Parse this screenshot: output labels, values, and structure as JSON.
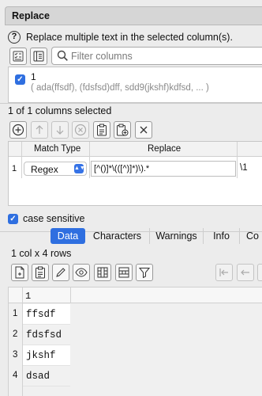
{
  "window": {
    "title": "Replace"
  },
  "help": {
    "text": "Replace multiple text in the selected column(s)."
  },
  "search": {
    "placeholder": "Filter columns",
    "value": ""
  },
  "columns": [
    {
      "name": "1",
      "values": "( ada(ffsdf), (fdsfsd)dff, sdd9(jkshf)kdfsd, ... )",
      "checked": true
    }
  ],
  "selection_summary": "1 of 1 columns selected",
  "replace_table": {
    "headers": [
      "Match Type",
      "Replace"
    ],
    "rows": [
      {
        "index": "1",
        "match_type": "Regex",
        "pattern": "[^()]*\\(([^)]*)\\).*",
        "replacement": "\\1"
      }
    ]
  },
  "case_sensitive": {
    "label": "case sensitive",
    "checked": true
  },
  "tabs": [
    "Data",
    "Characters",
    "Warnings",
    "Info",
    "Co"
  ],
  "active_tab": "Data",
  "data_summary": "1 col x 4 rows",
  "data_table": {
    "header": "1",
    "rows": [
      {
        "index": "1",
        "value": "ffsdf"
      },
      {
        "index": "2",
        "value": "fdsfsd"
      },
      {
        "index": "3",
        "value": "jkshf"
      },
      {
        "index": "4",
        "value": "dsad"
      }
    ]
  },
  "colors": {
    "accent": "#2f6fe0",
    "panel": "#ececec",
    "titlebar": "#d6d6d6"
  }
}
